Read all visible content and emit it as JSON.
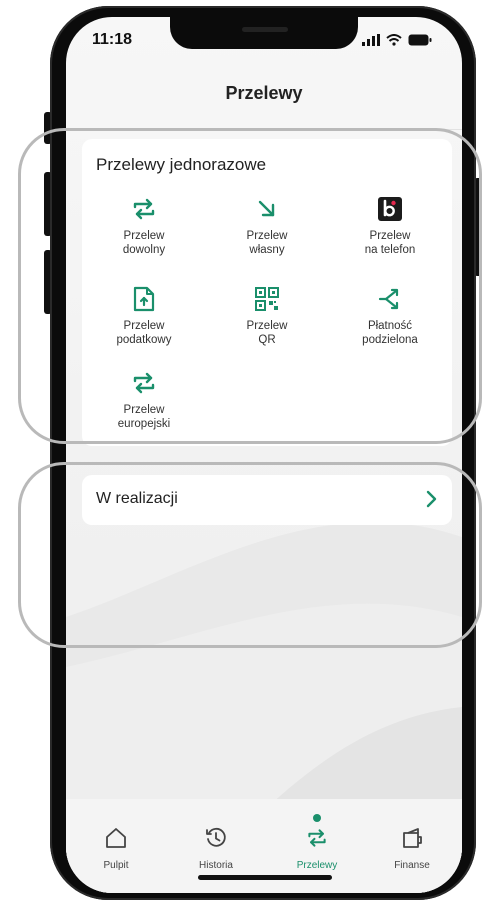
{
  "status_bar": {
    "time": "11:18"
  },
  "header": {
    "title": "Przelewy"
  },
  "transfers_card": {
    "title": "Przelewy jednorazowe",
    "tiles": [
      {
        "line1": "Przelew",
        "line2": "dowolny",
        "icon": "arrows-cycle-icon"
      },
      {
        "line1": "Przelew",
        "line2": "własny",
        "icon": "arrow-down-right-icon"
      },
      {
        "line1": "Przelew",
        "line2": "na telefon",
        "icon": "blik-icon"
      },
      {
        "line1": "Przelew",
        "line2": "podatkowy",
        "icon": "tax-document-icon"
      },
      {
        "line1": "Przelew",
        "line2": "QR",
        "icon": "qr-code-icon"
      },
      {
        "line1": "Płatność",
        "line2": "podzielona",
        "icon": "split-payment-icon"
      },
      {
        "line1": "Przelew",
        "line2": "europejski",
        "icon": "arrows-cycle-icon"
      }
    ]
  },
  "in_progress": {
    "label": "W realizacji"
  },
  "tabbar": {
    "tabs": [
      {
        "label": "Pulpit",
        "icon": "home-icon"
      },
      {
        "label": "Historia",
        "icon": "history-icon"
      },
      {
        "label": "Przelewy",
        "icon": "transfers-icon",
        "active": true
      },
      {
        "label": "Finanse",
        "icon": "finance-icon"
      }
    ]
  },
  "colors": {
    "accent": "#1a8f6b",
    "background": "#f4f4f4",
    "card": "#ffffff",
    "outline": "#b9b9b9"
  }
}
